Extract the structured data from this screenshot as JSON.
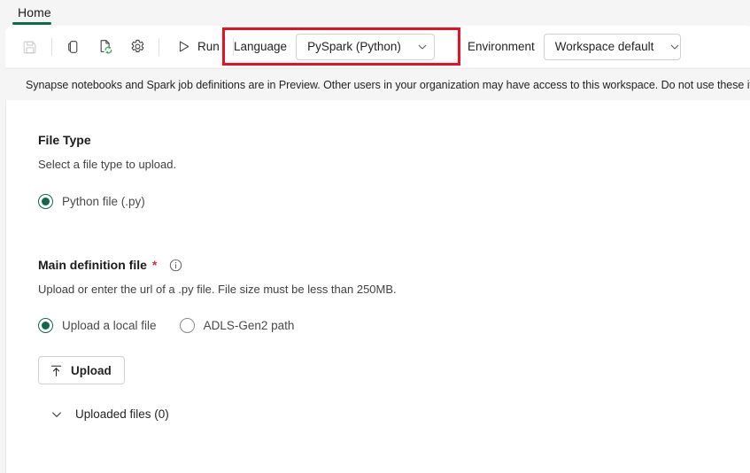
{
  "tabs": {
    "items": [
      {
        "label": "Home",
        "active": true
      }
    ]
  },
  "toolbar": {
    "icons": [
      {
        "name": "save-icon",
        "title": "Save",
        "disabled": true
      },
      {
        "name": "mobile-preview-icon",
        "title": "Mobile preview",
        "disabled": false
      },
      {
        "name": "publish-refresh-icon",
        "title": "Publish",
        "disabled": false
      },
      {
        "name": "settings-gear-icon",
        "title": "Settings",
        "disabled": false
      }
    ],
    "run_label": "Run",
    "language": {
      "label": "Language",
      "value": "PySpark (Python)"
    },
    "environment": {
      "label": "Environment",
      "value": "Workspace default"
    }
  },
  "annotation": {
    "highlight_color": "#e81123"
  },
  "banner": {
    "icon": "info-icon",
    "text": "Synapse notebooks and Spark job definitions are in Preview. Other users in your organization may have access to this workspace. Do not use these items"
  },
  "file_type": {
    "title": "File Type",
    "description": "Select a file type to upload.",
    "options": [
      {
        "label": "Python file (.py)",
        "selected": true
      }
    ]
  },
  "main_definition_file": {
    "title": "Main definition file",
    "required_marker": "*",
    "info_icon": "info-icon",
    "description": "Upload or enter the url of a .py file. File size must be less than 250MB.",
    "options": [
      {
        "label": "Upload a local file",
        "selected": true
      },
      {
        "label": "ADLS-Gen2 path",
        "selected": false
      }
    ],
    "upload_button": {
      "label": "Upload",
      "icon": "upload-arrow-icon"
    },
    "uploaded_files": {
      "label": "Uploaded files (0)",
      "icon": "chevron-down-icon",
      "expanded": false
    }
  },
  "colors": {
    "accent_green": "#0f6a4c",
    "required_red": "#c4314b",
    "annotation_red": "#e81123",
    "toolbar_bg": "#ffffff",
    "chrome_bg": "#f5f5f5"
  }
}
